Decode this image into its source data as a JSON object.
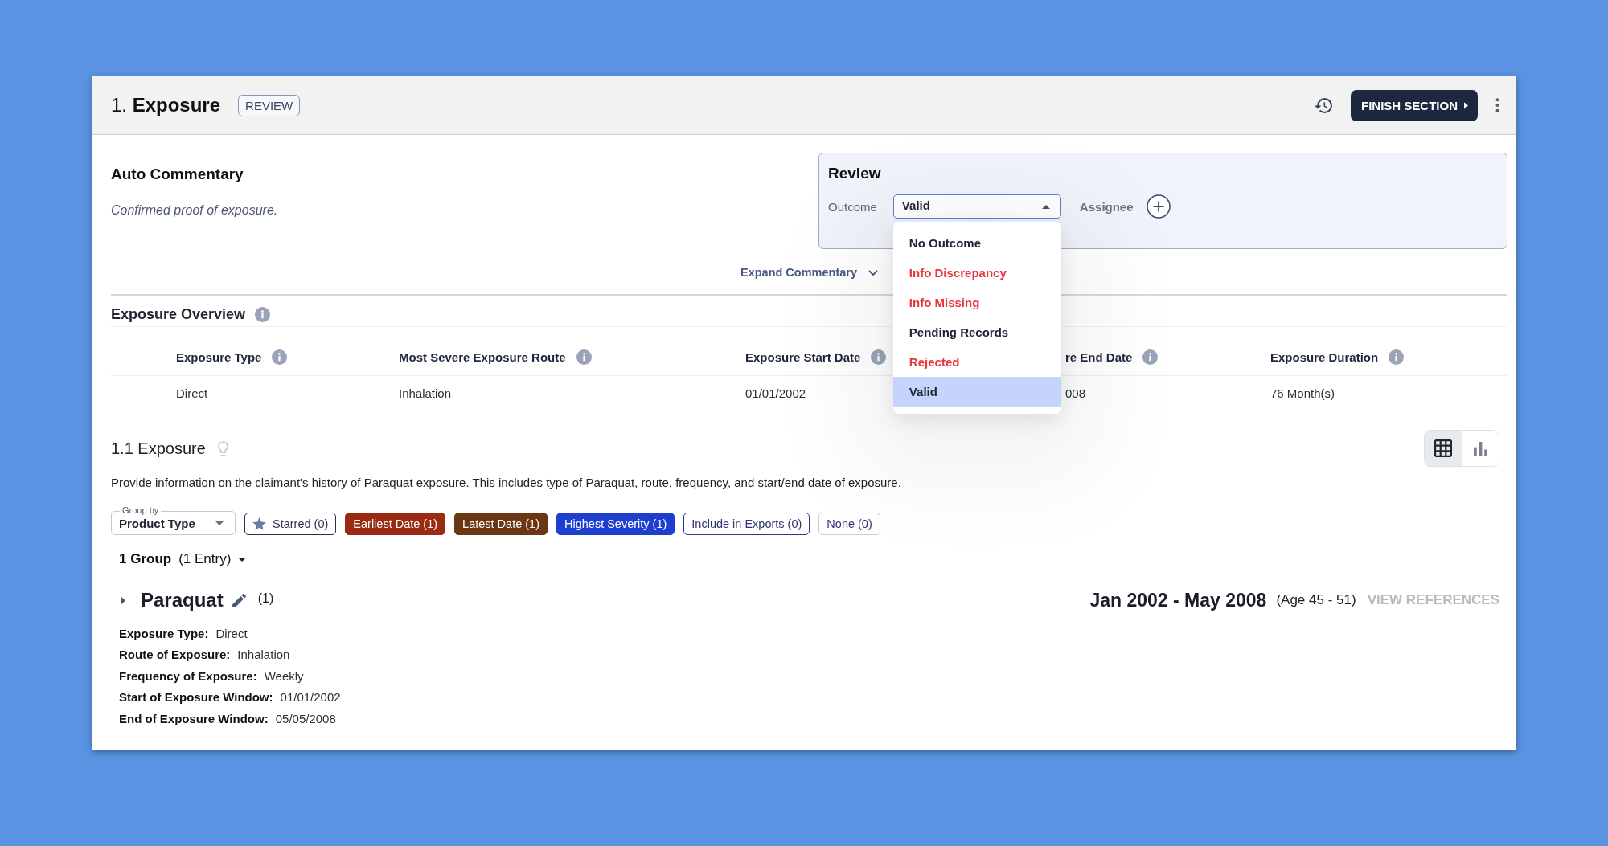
{
  "header": {
    "title": "1. **Exposure**",
    "badge": "REVIEW",
    "finish_button": "FINISH SECTION"
  },
  "auto_commentary": {
    "title": "Auto Commentary",
    "text": "Confirmed proof of exposure.",
    "expand_link": "Expand Commentary"
  },
  "review": {
    "title": "Review",
    "outcome_label": "Outcome",
    "outcome_value": "Valid",
    "expanded": true,
    "assignee_label": "Assignee",
    "options": [
      {
        "label": "No Outcome",
        "color": "#1f2433",
        "selected": false
      },
      {
        "label": "Info Discrepancy",
        "color": "#e8353b",
        "selected": false
      },
      {
        "label": "Info Missing",
        "color": "#e8353b",
        "selected": false
      },
      {
        "label": "Pending Records",
        "color": "#1f2433",
        "selected": false
      },
      {
        "label": "Rejected",
        "color": "#e8353b",
        "selected": false
      },
      {
        "label": "Valid",
        "color": "#1f2433",
        "selected": true
      }
    ]
  },
  "overview": {
    "title": "Exposure Overview",
    "columns": [
      "Exposure Type",
      "Most Severe Exposure Route",
      "Exposure Start Date",
      "re End Date",
      "Exposure Duration"
    ],
    "rows": [
      [
        "Direct",
        "Inhalation",
        "01/01/2002",
        "008",
        "76 Month(s)"
      ]
    ]
  },
  "section": {
    "title": "1.1 Exposure",
    "views": [
      {
        "selected": true
      },
      {
        "selected": false
      }
    ],
    "description": "Provide information on the claimant's history of Paraquat exposure. This includes type of Paraquat, route, frequency, and start/end date of exposure.",
    "group_by": {
      "label": "Group by",
      "value": "Product Type"
    },
    "filters": [
      {
        "label": "Starred (0)",
        "kind": "star",
        "color": "#27304d"
      },
      {
        "label": "Earliest Date (1)",
        "kind": "filled",
        "color": "#9a2b12"
      },
      {
        "label": "Latest Date (1)",
        "kind": "filled",
        "color": "#6b3613"
      },
      {
        "label": "Highest Severity (1)",
        "kind": "filled",
        "color": "#1e3ed0"
      },
      {
        "label": "Include in Exports (0)",
        "kind": "outline",
        "color": "#2f3790"
      },
      {
        "label": "None (0)",
        "kind": "outline",
        "color": "#c7cddc"
      }
    ],
    "group_summary": "**1 Group** (1 Entry)",
    "groups": [
      {
        "name": "Paraquat",
        "count": "(1)",
        "expanded": false,
        "date_range": "Jan 2002 - May 2008",
        "age": "(Age 45 - 51)",
        "references": {
          "label": "VIEW REFERENCES",
          "disabled": true
        },
        "fields": [
          {
            "label": "Exposure Type:",
            "value": "Direct"
          },
          {
            "label": "Route of Exposure:",
            "value": "Inhalation"
          },
          {
            "label": "Frequency of Exposure:",
            "value": "Weekly"
          },
          {
            "label": "Start of Exposure Window:",
            "value": "01/01/2002"
          },
          {
            "label": "End of Exposure Window:",
            "value": "05/05/2008"
          }
        ]
      }
    ]
  }
}
